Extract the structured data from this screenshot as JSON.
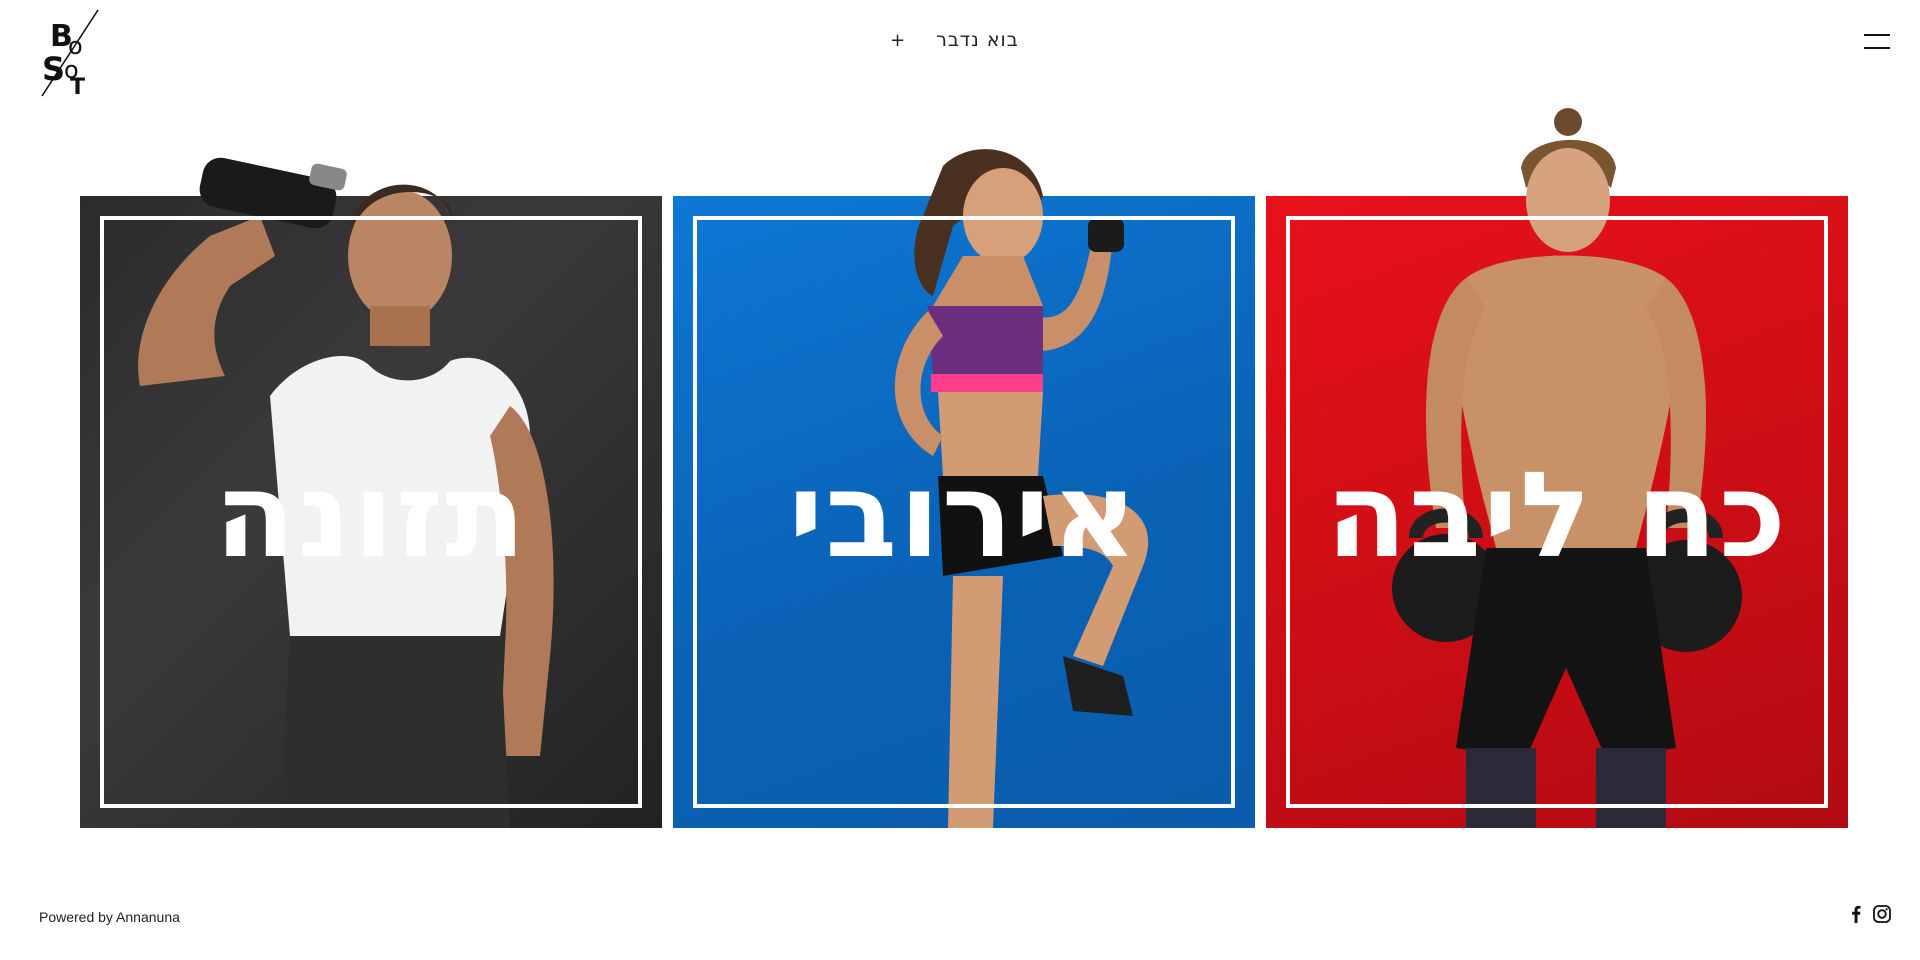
{
  "header": {
    "logo_text": "BOOST",
    "contact_plus": "+",
    "contact_label": "בוא נדבר"
  },
  "panels": [
    {
      "id": "nutrition",
      "title": "תזונה",
      "color": "#2b2b2b"
    },
    {
      "id": "aerobic",
      "title": "אירובי",
      "color": "#0a6fcf"
    },
    {
      "id": "strength",
      "title": "כח ליבה",
      "color": "#e0101a"
    }
  ],
  "footer": {
    "powered_by": "Powered by Annanuna",
    "social": [
      "facebook-icon",
      "instagram-icon"
    ]
  },
  "colors": {
    "nutrition_bg": "#2b2b2b",
    "aerobic_bg": "#0a6fcf",
    "strength_bg": "#e0101a",
    "frame": "#ffffff"
  }
}
